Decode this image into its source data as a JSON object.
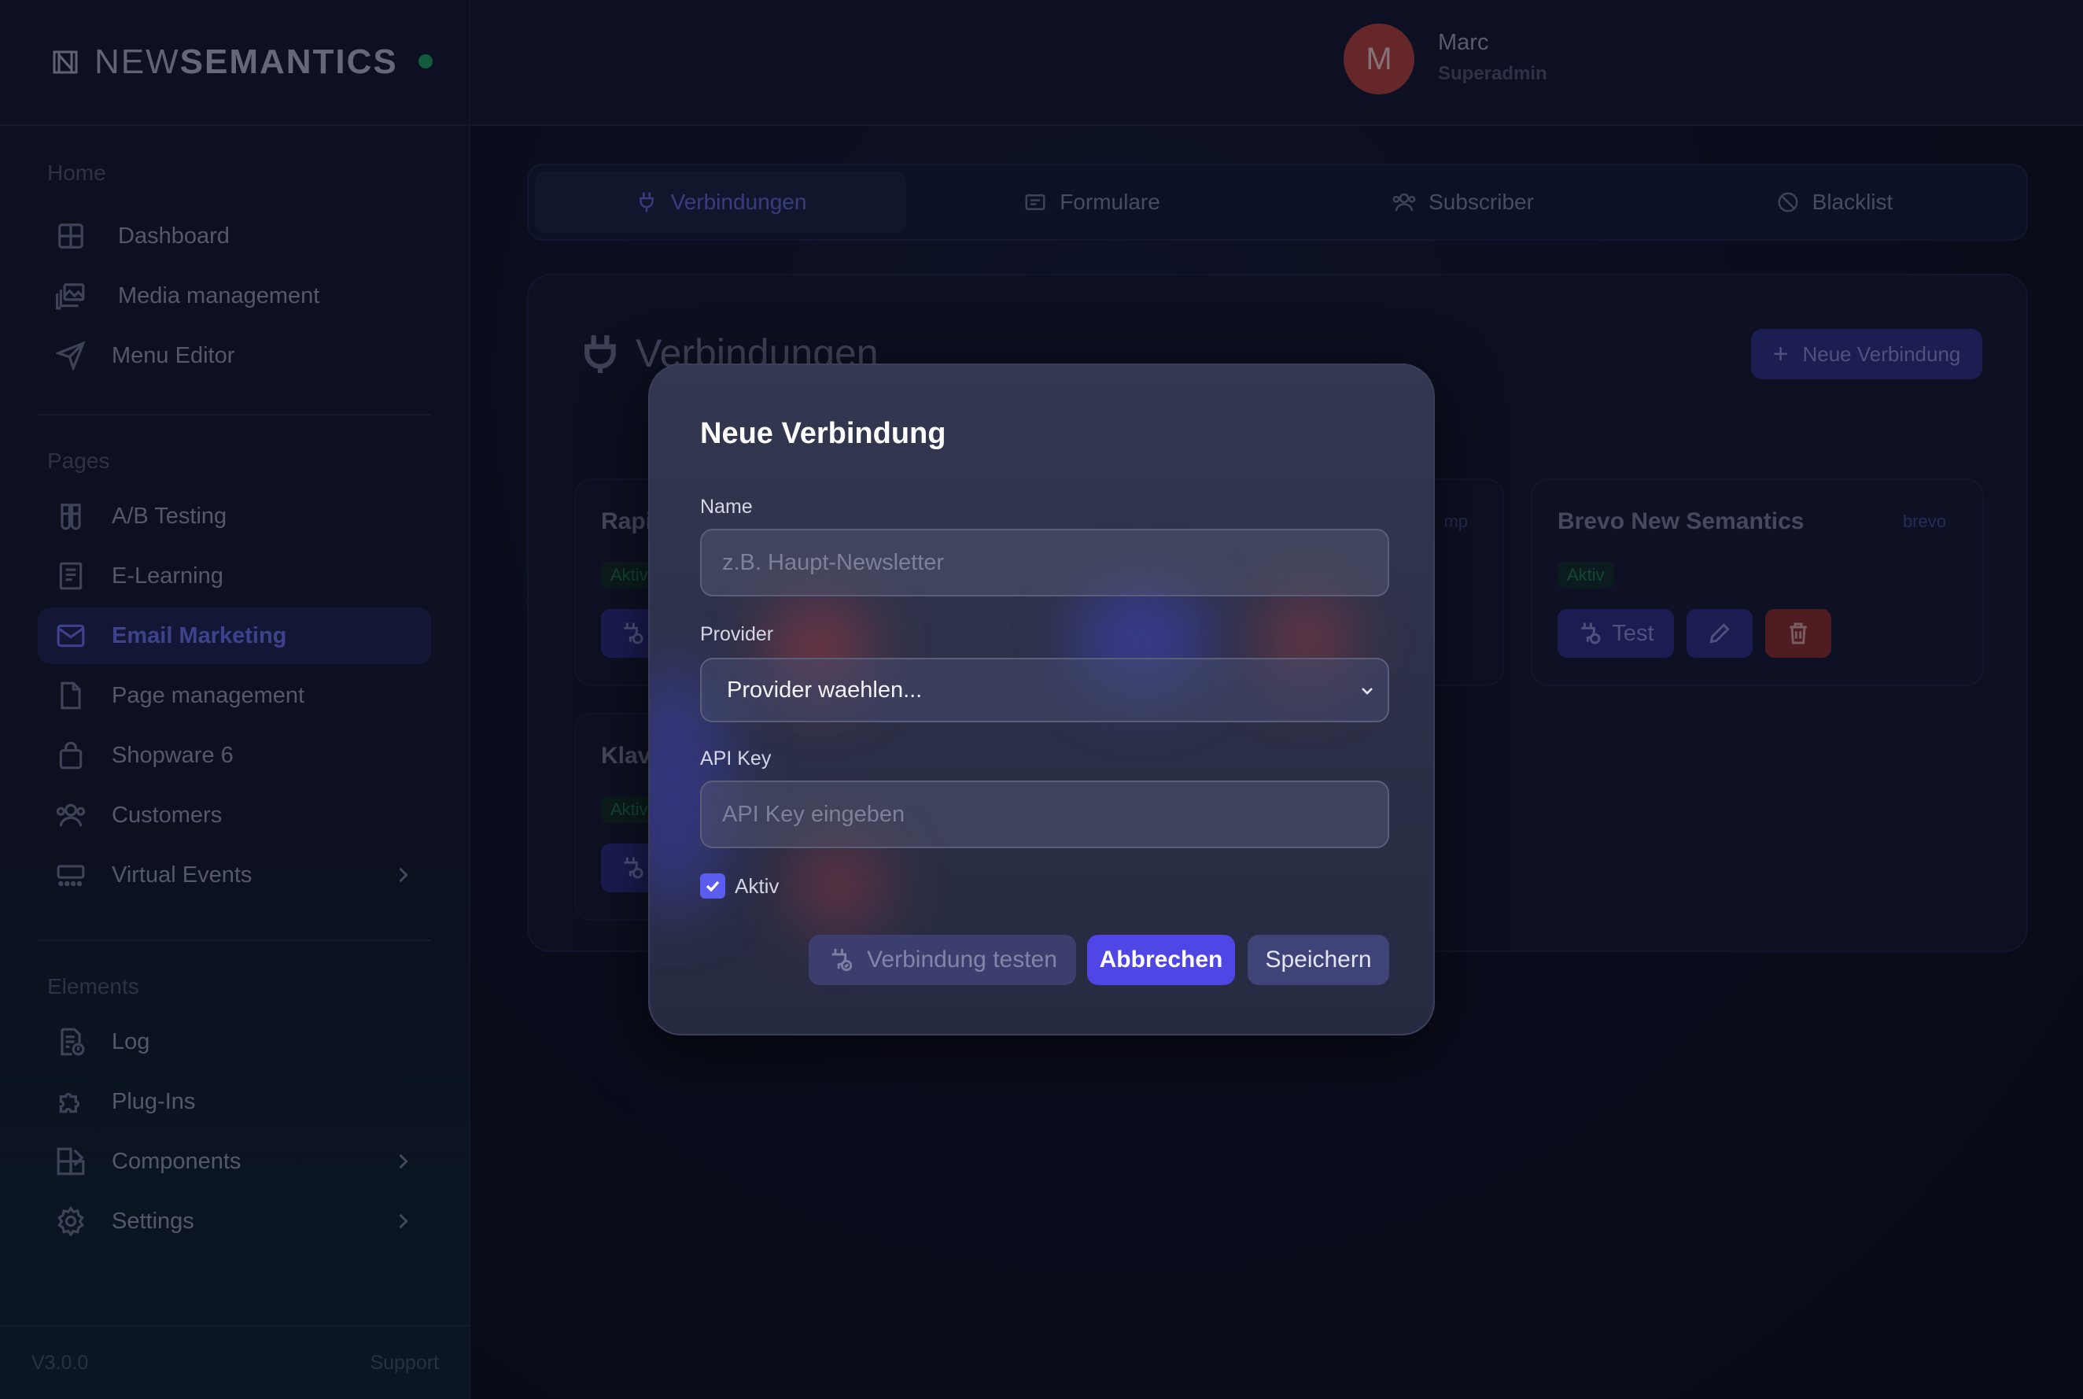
{
  "brand": {
    "prefix": "NEW",
    "suffix": "SEMANTICS"
  },
  "sidebar": {
    "sections": [
      {
        "label": "Home",
        "items": [
          {
            "label": "Dashboard",
            "icon": "grid-icon"
          },
          {
            "label": "Media management",
            "icon": "images-icon"
          },
          {
            "label": "Menu Editor",
            "icon": "send-icon"
          }
        ]
      },
      {
        "label": "Pages",
        "items": [
          {
            "label": "A/B Testing",
            "icon": "test-tubes-icon"
          },
          {
            "label": "E-Learning",
            "icon": "book-icon"
          },
          {
            "label": "Email Marketing",
            "icon": "mail-icon",
            "active": true
          },
          {
            "label": "Page management",
            "icon": "file-icon"
          },
          {
            "label": "Shopware 6",
            "icon": "shopping-bag-icon"
          },
          {
            "label": "Customers",
            "icon": "users-icon"
          },
          {
            "label": "Virtual Events",
            "icon": "screen-icon",
            "has_submenu": true
          }
        ]
      },
      {
        "label": "Elements",
        "items": [
          {
            "label": "Log",
            "icon": "log-file-icon"
          },
          {
            "label": "Plug-Ins",
            "icon": "puzzle-icon"
          },
          {
            "label": "Components",
            "icon": "components-icon",
            "has_submenu": true
          },
          {
            "label": "Settings",
            "icon": "gear-icon",
            "has_submenu": true
          }
        ]
      }
    ],
    "footer": {
      "version": "V3.0.0",
      "support": "Support"
    }
  },
  "user": {
    "initial": "M",
    "name": "Marc",
    "role": "Superadmin"
  },
  "tabs": [
    {
      "label": "Verbindungen",
      "icon": "plug-icon",
      "active": true
    },
    {
      "label": "Formulare",
      "icon": "form-icon"
    },
    {
      "label": "Subscriber",
      "icon": "users-icon"
    },
    {
      "label": "Blacklist",
      "icon": "ban-icon"
    }
  ],
  "panel": {
    "title": "Verbindungen",
    "new_button": "Neue Verbindung",
    "cards": {
      "rapid": {
        "title": "Rapi",
        "status": "Aktiv"
      },
      "klaviyo": {
        "title": "Klav",
        "status": "Aktiv"
      },
      "mailchimp": {
        "tag": "mp"
      },
      "brevo": {
        "title": "Brevo New Semantics",
        "tag": "brevo",
        "status": "Aktiv",
        "test_label": "Test"
      }
    }
  },
  "modal": {
    "title": "Neue Verbindung",
    "name_label": "Name",
    "name_placeholder": "z.B. Haupt-Newsletter",
    "provider_label": "Provider",
    "provider_value": "Provider waehlen...",
    "apikey_label": "API Key",
    "apikey_placeholder": "API Key eingeben",
    "active_label": "Aktiv",
    "active_checked": true,
    "test_button": "Verbindung testen",
    "cancel_button": "Abbrechen",
    "save_button": "Speichern"
  },
  "colors": {
    "accent": "#4f46e5",
    "success": "#1f9d5f",
    "danger": "#b4403f"
  }
}
